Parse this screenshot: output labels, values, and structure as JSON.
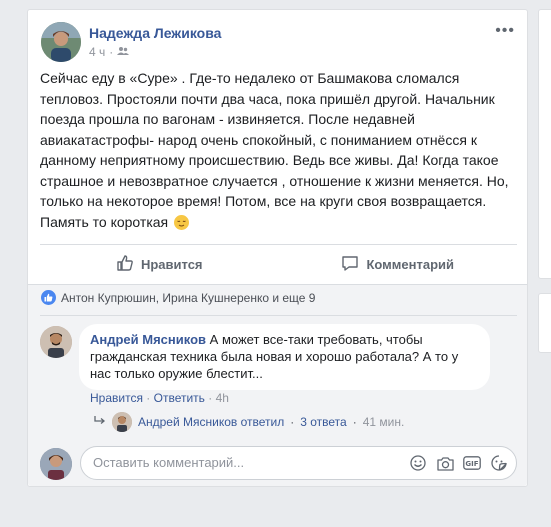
{
  "post": {
    "author": "Надежда Лежикова",
    "time": "4 ч",
    "separator": "·",
    "text": "Сейчас еду в «Суре» . Где-то недалеко от Башмакова сломался тепловоз. Простояли почти два часа, пока пришёл другой. Начальник поезда прошла по вагонам - извиняется. После недавней авиакатастрофы- народ очень спокойный, с пониманием отнёсся к данному неприятному происшествию. Ведь все живы. Да! Когда такое страшное и невозвратное случается , отношение к жизни меняется. Но, только на некоторое время! Потом, все на круги своя возвращается. Память то короткая"
  },
  "actions": {
    "like": "Нравится",
    "comment": "Комментарий"
  },
  "reactions": {
    "summary": "Антон Купрюшин, Ирина Кушнеренко и еще 9"
  },
  "comment": {
    "author": "Андрей Мясников",
    "text": "А может все-таки требовать, чтобы гражданская техника была новая и хорошо работала? А то у нас только оружие блестит...",
    "like": "Нравится",
    "reply": "Ответить",
    "dot": "·",
    "time": "4h"
  },
  "replies": {
    "author_replied": "Андрей Мясников ответил",
    "count": "3 ответа",
    "time": "41 мин.",
    "dot": "·"
  },
  "composer": {
    "placeholder": "Оставить комментарий..."
  },
  "colors": {
    "link": "#385898",
    "muted": "#90949c",
    "like_badge": "#4a87f0"
  }
}
